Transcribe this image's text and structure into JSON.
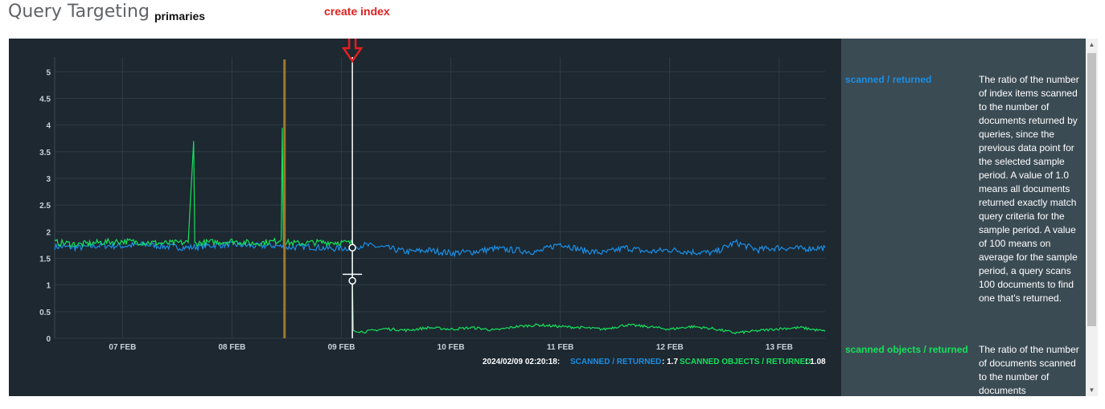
{
  "header": {
    "title": "Query Targeting",
    "subtitle": "primaries"
  },
  "annotation": {
    "label": "create index",
    "color": "#e02020"
  },
  "colors": {
    "panel_bg": "#1d2831",
    "legend_bg": "#3b4b54",
    "scanned_returned": "#1a8fe6",
    "scanned_objects": "#15e15a",
    "event_marker": "#a0782a"
  },
  "tooltip": {
    "timestamp": "2024/02/09 02:20:18:",
    "series1_label": "SCANNED / RETURNED",
    "series1_value": ": 1.7",
    "series2_label": "SCANNED OBJECTS / RETURNED",
    "series2_value": ": 1.08"
  },
  "legend": {
    "items": [
      {
        "name": "scanned / returned",
        "description": "The ratio of the number of index items scanned to the number of documents returned by queries, since the previous data point for the selected sample period. A value of 1.0 means all documents returned exactly match query criteria for the sample period. A value of 100 means on average for the sample period, a query scans 100 documents to find one that's returned."
      },
      {
        "name": "scanned objects / returned",
        "description": "The ratio of the number of documents scanned to the number of documents"
      }
    ]
  },
  "chart_data": {
    "type": "line",
    "x_ticks": [
      "07 FEB",
      "08 FEB",
      "09 FEB",
      "10 FEB",
      "11 FEB",
      "12 FEB",
      "13 FEB"
    ],
    "y_ticks": [
      "0",
      "0.5",
      "1",
      "1.5",
      "2",
      "2.5",
      "3",
      "3.5",
      "4",
      "4.5",
      "5"
    ],
    "ylim": [
      0,
      5.2
    ],
    "x_range_days": [
      6.38,
      13.42
    ],
    "grid": true,
    "event_marker_x_day": 8.48,
    "crosshair_x_day": 9.1,
    "series": [
      {
        "name": "scanned / returned",
        "points": [
          [
            6.38,
            1.72
          ],
          [
            6.6,
            1.7
          ],
          [
            6.8,
            1.74
          ],
          [
            7.0,
            1.73
          ],
          [
            7.2,
            1.76
          ],
          [
            7.4,
            1.72
          ],
          [
            7.6,
            1.7
          ],
          [
            7.8,
            1.74
          ],
          [
            8.0,
            1.76
          ],
          [
            8.2,
            1.73
          ],
          [
            8.4,
            1.74
          ],
          [
            8.5,
            1.7
          ],
          [
            8.7,
            1.72
          ],
          [
            8.9,
            1.68
          ],
          [
            9.1,
            1.7
          ],
          [
            9.2,
            1.75
          ],
          [
            9.4,
            1.7
          ],
          [
            9.6,
            1.62
          ],
          [
            9.8,
            1.65
          ],
          [
            10.0,
            1.6
          ],
          [
            10.2,
            1.62
          ],
          [
            10.4,
            1.68
          ],
          [
            10.6,
            1.65
          ],
          [
            10.8,
            1.62
          ],
          [
            11.0,
            1.78
          ],
          [
            11.2,
            1.65
          ],
          [
            11.4,
            1.6
          ],
          [
            11.6,
            1.7
          ],
          [
            11.8,
            1.62
          ],
          [
            12.0,
            1.66
          ],
          [
            12.2,
            1.62
          ],
          [
            12.4,
            1.6
          ],
          [
            12.6,
            1.8
          ],
          [
            12.8,
            1.66
          ],
          [
            13.0,
            1.7
          ],
          [
            13.2,
            1.68
          ],
          [
            13.42,
            1.7
          ]
        ]
      },
      {
        "name": "scanned objects / returned",
        "points": [
          [
            6.38,
            1.8
          ],
          [
            6.6,
            1.76
          ],
          [
            6.8,
            1.8
          ],
          [
            7.0,
            1.82
          ],
          [
            7.2,
            1.8
          ],
          [
            7.4,
            1.78
          ],
          [
            7.6,
            1.8
          ],
          [
            7.65,
            3.7
          ],
          [
            7.66,
            1.78
          ],
          [
            7.8,
            1.8
          ],
          [
            8.0,
            1.82
          ],
          [
            8.2,
            1.78
          ],
          [
            8.4,
            1.82
          ],
          [
            8.45,
            1.85
          ],
          [
            8.46,
            3.95
          ],
          [
            8.47,
            1.8
          ],
          [
            8.6,
            1.78
          ],
          [
            8.8,
            1.8
          ],
          [
            9.0,
            1.8
          ],
          [
            9.1,
            1.78
          ],
          [
            9.1,
            1.08
          ],
          [
            9.11,
            0.15
          ],
          [
            9.2,
            0.12
          ],
          [
            9.4,
            0.18
          ],
          [
            9.6,
            0.15
          ],
          [
            9.8,
            0.2
          ],
          [
            10.0,
            0.17
          ],
          [
            10.2,
            0.2
          ],
          [
            10.4,
            0.15
          ],
          [
            10.6,
            0.22
          ],
          [
            10.8,
            0.25
          ],
          [
            11.0,
            0.22
          ],
          [
            11.2,
            0.2
          ],
          [
            11.4,
            0.17
          ],
          [
            11.6,
            0.25
          ],
          [
            11.8,
            0.22
          ],
          [
            12.0,
            0.17
          ],
          [
            12.2,
            0.22
          ],
          [
            12.4,
            0.18
          ],
          [
            12.6,
            0.1
          ],
          [
            12.8,
            0.14
          ],
          [
            13.0,
            0.18
          ],
          [
            13.2,
            0.2
          ],
          [
            13.42,
            0.13
          ]
        ]
      }
    ]
  }
}
